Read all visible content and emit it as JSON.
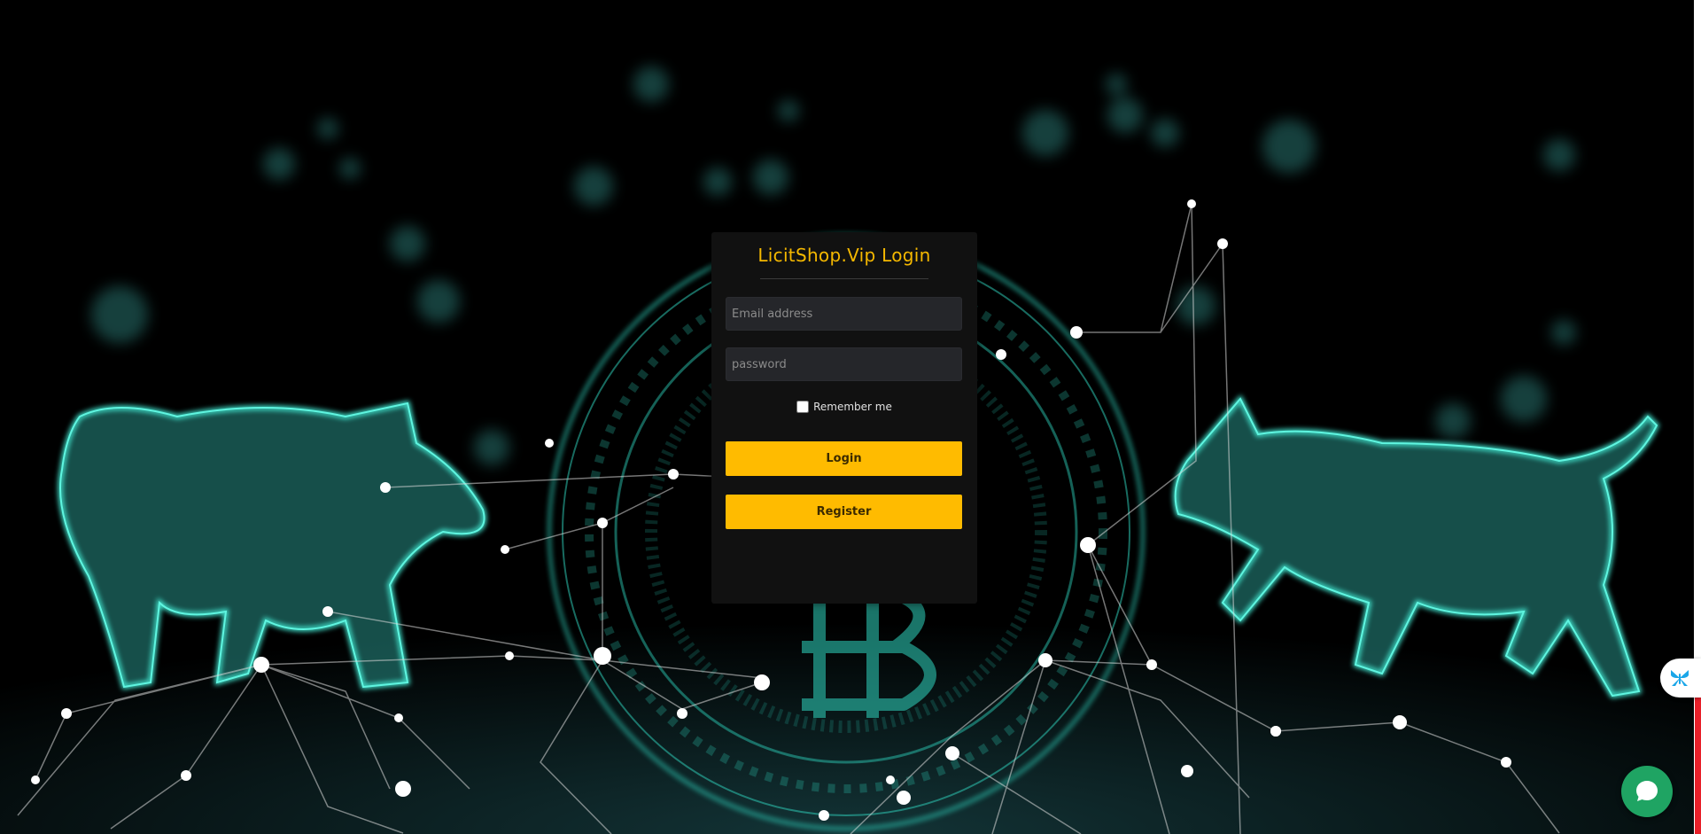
{
  "login": {
    "title": "LicitShop.Vip Login",
    "email_placeholder": "Email address",
    "password_placeholder": "password",
    "remember_label": "Remember me",
    "login_label": "Login",
    "register_label": "Register"
  },
  "theme": {
    "accent": "#ffbb00",
    "title_color": "#f5b800",
    "card_bg": "#111111",
    "glow": "#2fd6c0",
    "chat_green": "#1fa463"
  },
  "widgets": {
    "side_widget_icon": "butterfly-icon",
    "chat_icon": "chat-bubble-icon"
  }
}
